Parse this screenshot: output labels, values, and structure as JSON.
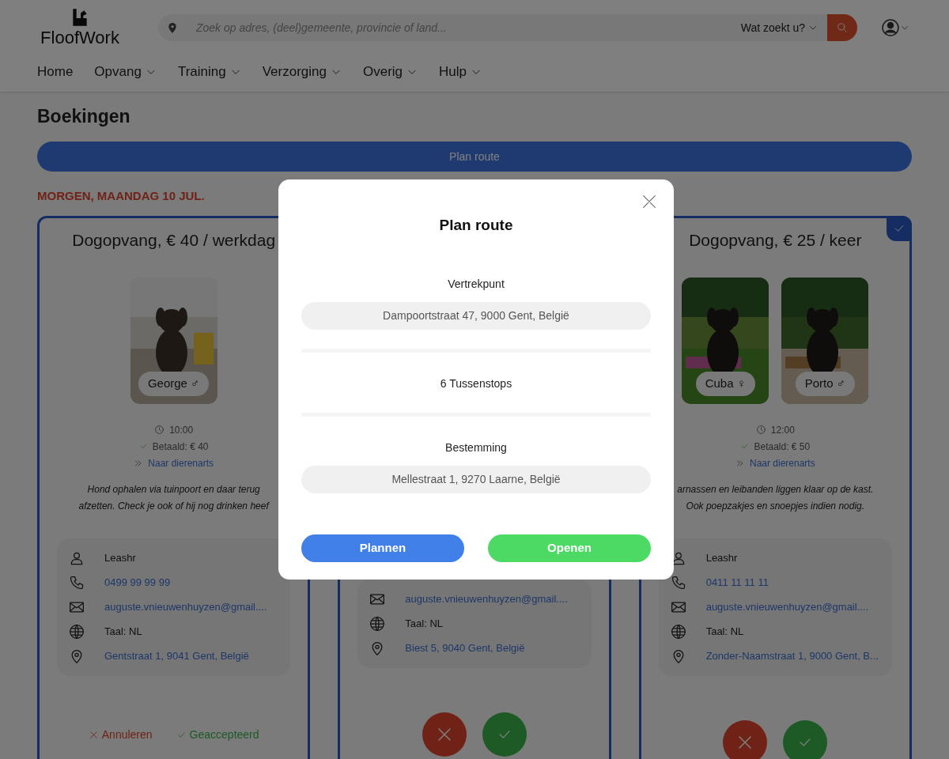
{
  "header": {
    "logo": "FloofWork",
    "search": {
      "placeholder": "Zoek op adres, (deel)gemeente, provincie of land...",
      "category": "Wat zoekt u?"
    }
  },
  "nav": [
    {
      "label": "Home",
      "has_menu": false
    },
    {
      "label": "Opvang",
      "has_menu": true
    },
    {
      "label": "Training",
      "has_menu": true
    },
    {
      "label": "Verzorging",
      "has_menu": true
    },
    {
      "label": "Overig",
      "has_menu": true
    },
    {
      "label": "Hulp",
      "has_menu": true
    }
  ],
  "page_title": "Boekingen",
  "plan_route_button": "Plan route",
  "date_heading": "MORGEN, MAANDAG 10 JUL.",
  "cards": [
    {
      "kind": "accepted",
      "title": "Dogopvang, € 40 / werkdag",
      "pets": [
        {
          "name": "George ♂"
        }
      ],
      "time": "10:00",
      "paid": "Betaald: € 40",
      "link": "Naar dierenarts",
      "note": "Hond ophalen via tuinpoort en daar terug afzetten. Check je ook of hij nog drinken heef",
      "contact": [
        {
          "kind": "person",
          "text": "Leashr"
        },
        {
          "kind": "phone",
          "text": "0499 99 99 99"
        },
        {
          "kind": "email",
          "text": "auguste.vnieuwenhuyzen@gmail...."
        },
        {
          "kind": "language",
          "text": "Taal: NL"
        },
        {
          "kind": "address",
          "text": "Gentstraat 1, 9041 Gent, België"
        }
      ],
      "cancel": "Annuleren",
      "status": "Geaccepteerd"
    },
    {
      "kind": "pending",
      "contact": [
        {
          "kind": "email",
          "text": "auguste.vnieuwenhuyzen@gmail...."
        },
        {
          "kind": "language",
          "text": "Taal: NL"
        },
        {
          "kind": "address",
          "text": "Biest 5, 9040 Gent, België"
        }
      ]
    },
    {
      "kind": "pending",
      "checked": true,
      "title": "Dogopvang, € 25 / keer",
      "pets": [
        {
          "name": "Cuba ♀"
        },
        {
          "name": "Porto ♂"
        }
      ],
      "time": "12:00",
      "paid": "Betaald: € 50",
      "link": "Naar dierenarts",
      "note": "arnassen en leibanden liggen klaar op de kast. Ook poepzakjes en snoepjes indien nodig.",
      "contact": [
        {
          "kind": "person",
          "text": "Leashr"
        },
        {
          "kind": "phone",
          "text": "0411 11 11 11"
        },
        {
          "kind": "email",
          "text": "auguste.vnieuwenhuyzen@gmail...."
        },
        {
          "kind": "language",
          "text": "Taal: NL"
        },
        {
          "kind": "address",
          "text": "Zonder-Naamstraat 1, 9000 Gent, B..."
        }
      ]
    }
  ],
  "modal": {
    "title": "Plan route",
    "start_label": "Vertrekpunt",
    "start_value": "Dampoortstraat 47, 9000 Gent, België",
    "stops": "6 Tussenstops",
    "end_label": "Bestemming",
    "end_value": "Mellestraat 1, 9270 Laarne, België",
    "buttons": [
      {
        "kind": "plan",
        "label": "Plannen"
      },
      {
        "kind": "open",
        "label": "Openen"
      }
    ]
  }
}
